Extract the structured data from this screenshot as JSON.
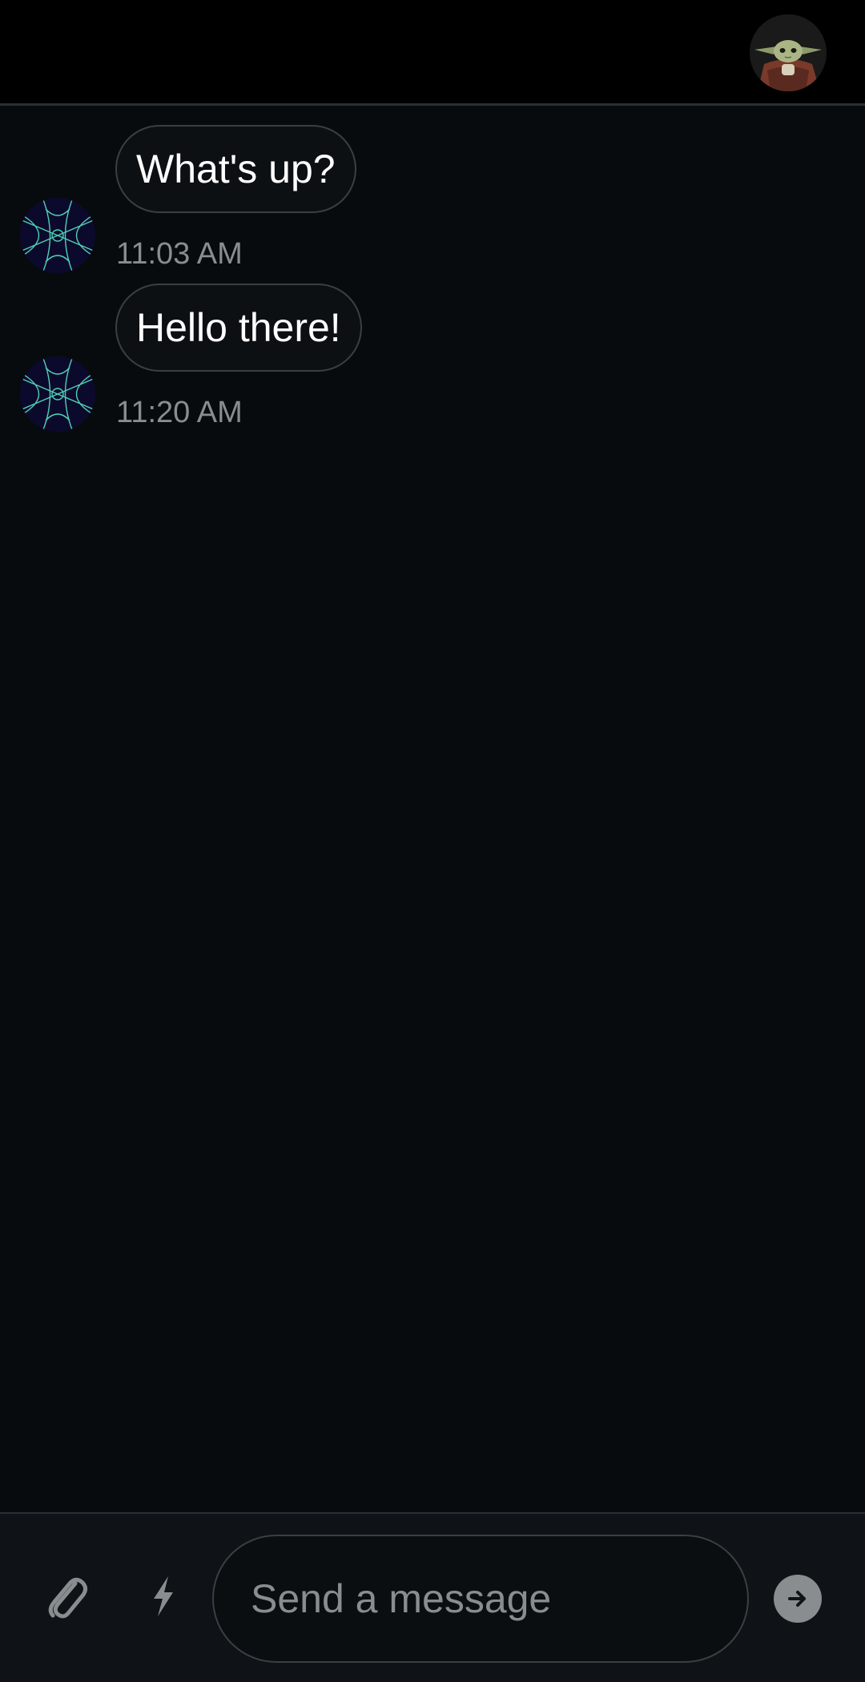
{
  "header": {
    "avatar_icon": "baby-yoda-avatar"
  },
  "messages": [
    {
      "text": "What's up?",
      "time": "11:03 AM",
      "avatar_icon": "geometric-pattern-avatar"
    },
    {
      "text": "Hello there!",
      "time": "11:20 AM",
      "avatar_icon": "geometric-pattern-avatar"
    }
  ],
  "composer": {
    "placeholder": "Send a message",
    "value": "",
    "attach_icon": "paperclip-icon",
    "bolt_icon": "lightning-bolt-icon",
    "send_icon": "arrow-right-icon"
  },
  "colors": {
    "background": "#080b0e",
    "header_background": "#000000",
    "bubble_border": "#3a3f44",
    "text_primary": "#ffffff",
    "text_muted": "#8a8d90",
    "avatar_pattern": "#4fd1b5"
  }
}
